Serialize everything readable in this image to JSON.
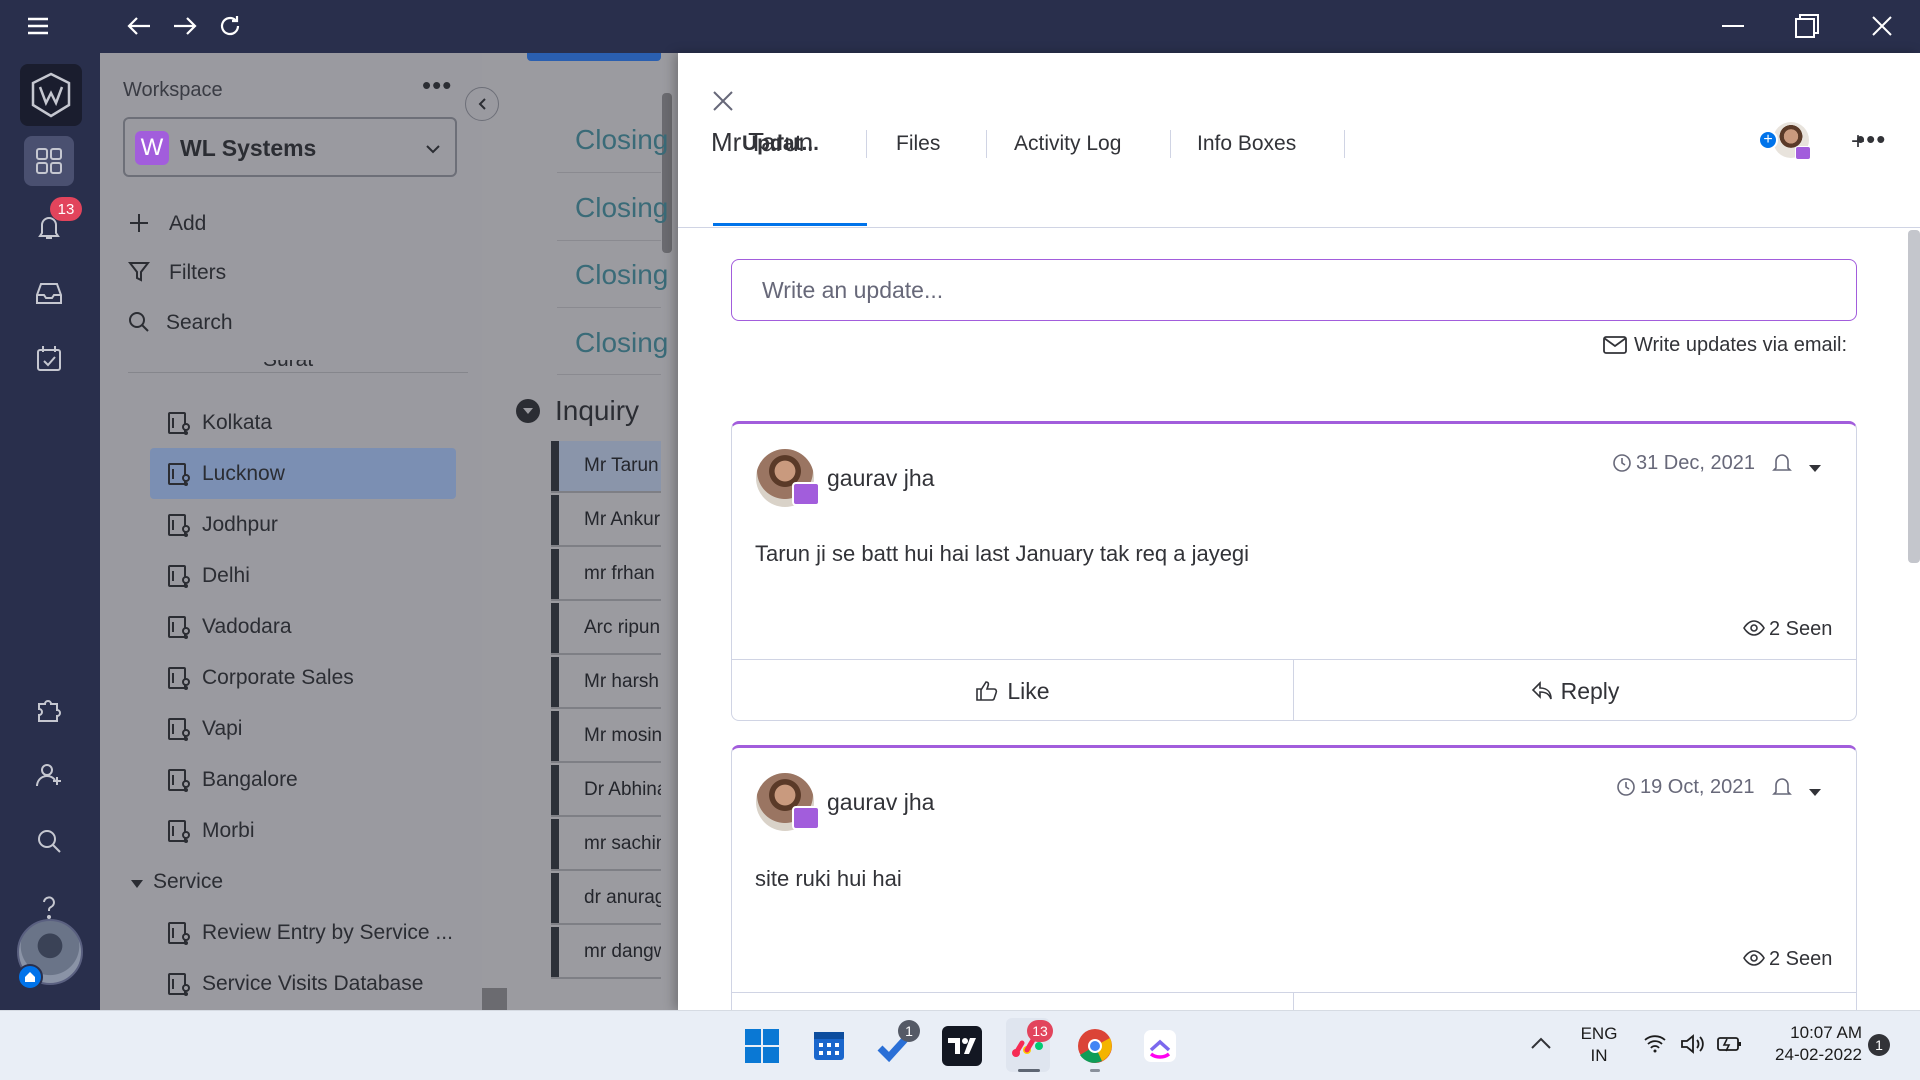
{
  "titlebar": {
    "menu_icon": "hamburger-icon",
    "back_icon": "arrow-left-icon",
    "forward_icon": "arrow-right-icon",
    "refresh_icon": "refresh-icon",
    "min_icon": "minimize-icon",
    "max_icon": "restore-icon",
    "close_icon": "close-icon"
  },
  "rail": {
    "notifications_count": "13"
  },
  "workspace": {
    "title": "Workspace",
    "name": "WL Systems",
    "avatar_letter": "W",
    "actions": [
      {
        "label": "Add"
      },
      {
        "label": "Filters"
      },
      {
        "label": "Search"
      }
    ],
    "partial_item": "Surat",
    "boards": [
      {
        "label": "Kolkata"
      },
      {
        "label": "Lucknow"
      },
      {
        "label": "Jodhpur"
      },
      {
        "label": "Delhi"
      },
      {
        "label": "Vadodara"
      },
      {
        "label": "Corporate Sales"
      },
      {
        "label": "Vapi"
      },
      {
        "label": "Bangalore"
      },
      {
        "label": "Morbi"
      }
    ],
    "folder": "Service",
    "folder_boards": [
      {
        "label": "Review Entry by Service ..."
      },
      {
        "label": "Service Visits Database"
      }
    ]
  },
  "board": {
    "closing_items": [
      "Closing",
      "Closing",
      "Closing",
      "Closing"
    ],
    "group_title": "Inquiry",
    "rows": [
      "Mr Tarun",
      "Mr Ankur",
      "mr frhan",
      "Arc ripun",
      "Mr harsh",
      "Mr mosin",
      "Dr Abhinav",
      "mr sachin",
      "dr anurag",
      "mr dangwal"
    ]
  },
  "panel": {
    "title": "Mr Tarun",
    "tabs": [
      {
        "label": "Updat..."
      },
      {
        "label": "Files"
      },
      {
        "label": "Activity Log"
      },
      {
        "label": "Info Boxes"
      }
    ],
    "add_tab": "+",
    "update_placeholder": "Write an update...",
    "email_link": "Write updates via email:",
    "updates": [
      {
        "author": "gaurav jha",
        "date": "31 Dec, 2021",
        "body": "Tarun ji se batt hui hai last January tak req a jayegi",
        "seen": "2 Seen",
        "like": "Like",
        "reply": "Reply"
      },
      {
        "author": "gaurav jha",
        "date": "19 Oct, 2021",
        "body": "site ruki hui hai",
        "seen": "2 Seen"
      }
    ]
  },
  "taskbar": {
    "todo_badge": "1",
    "monday_badge": "13",
    "lang_top": "ENG",
    "lang_bottom": "IN",
    "time": "10:07 AM",
    "date": "24-02-2022",
    "notif_count": "1"
  },
  "colors": {
    "accent": "#a25ddc",
    "blue": "#0073ea",
    "dark": "#292f4c"
  }
}
